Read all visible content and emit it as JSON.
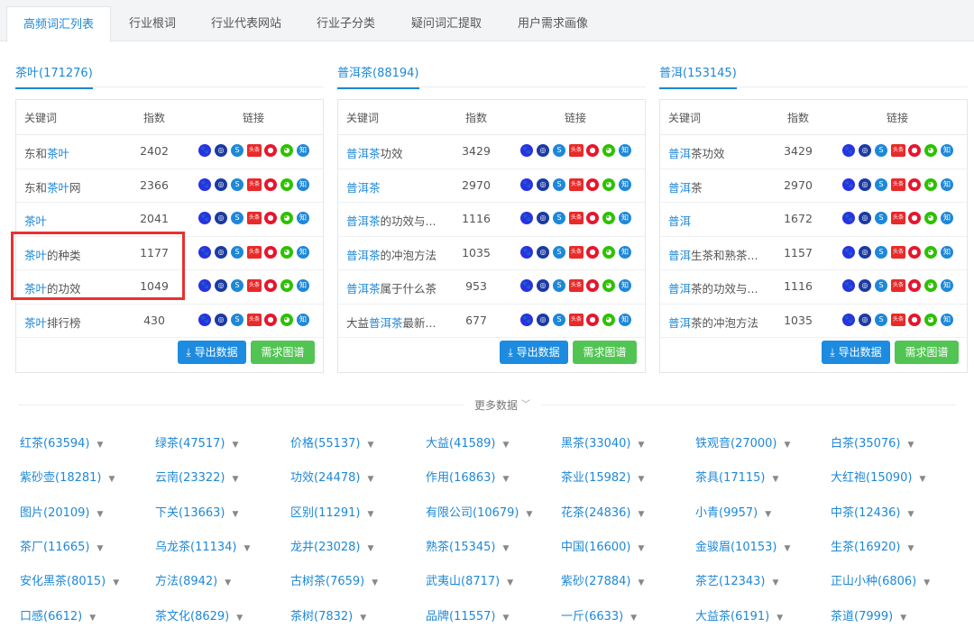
{
  "tabs": [
    "高频词汇列表",
    "行业根词",
    "行业代表网站",
    "行业子分类",
    "疑问词汇提取",
    "用户需求画像"
  ],
  "table_headers": {
    "keyword": "关键词",
    "index": "指数",
    "links": "链接"
  },
  "buttons": {
    "export": "导出数据",
    "map": "需求图谱"
  },
  "icon_labels": {
    "toutiao": "头条",
    "zhihu": "知"
  },
  "panels": [
    {
      "title": "茶叶(171276)",
      "rows": [
        {
          "pre": "东和",
          "hl": "茶叶",
          "post": "",
          "index": "2402"
        },
        {
          "pre": "东和",
          "hl": "茶叶",
          "post": "网",
          "index": "2366"
        },
        {
          "pre": "",
          "hl": "茶叶",
          "post": "",
          "index": "2041"
        },
        {
          "pre": "",
          "hl": "茶叶",
          "post": "的种类",
          "index": "1177"
        },
        {
          "pre": "",
          "hl": "茶叶",
          "post": "的功效",
          "index": "1049"
        },
        {
          "pre": "",
          "hl": "茶叶",
          "post": "排行榜",
          "index": "430"
        }
      ]
    },
    {
      "title": "普洱茶(88194)",
      "rows": [
        {
          "pre": "",
          "hl": "普洱茶",
          "post": "功效",
          "index": "3429"
        },
        {
          "pre": "",
          "hl": "普洱茶",
          "post": "",
          "index": "2970"
        },
        {
          "pre": "",
          "hl": "普洱茶",
          "post": "的功效与...",
          "index": "1116"
        },
        {
          "pre": "",
          "hl": "普洱茶",
          "post": "的冲泡方法",
          "index": "1035"
        },
        {
          "pre": "",
          "hl": "普洱茶",
          "post": "属于什么茶",
          "index": "953"
        },
        {
          "pre": "大益",
          "hl": "普洱茶",
          "post": "最新...",
          "index": "677"
        }
      ]
    },
    {
      "title": "普洱(153145)",
      "rows": [
        {
          "pre": "",
          "hl": "普洱",
          "post": "茶功效",
          "index": "3429"
        },
        {
          "pre": "",
          "hl": "普洱",
          "post": "茶",
          "index": "2970"
        },
        {
          "pre": "",
          "hl": "普洱",
          "post": "",
          "index": "1672"
        },
        {
          "pre": "",
          "hl": "普洱",
          "post": "生茶和熟茶...",
          "index": "1157"
        },
        {
          "pre": "",
          "hl": "普洱",
          "post": "茶的功效与...",
          "index": "1116"
        },
        {
          "pre": "",
          "hl": "普洱",
          "post": "茶的冲泡方法",
          "index": "1035"
        }
      ]
    }
  ],
  "more_data": "更多数据",
  "categories": [
    [
      "红茶(63594)",
      "绿茶(47517)",
      "价格(55137)",
      "大益(41589)",
      "黑茶(33040)",
      "铁观音(27000)",
      "白茶(35076)"
    ],
    [
      "紫砂壶(18281)",
      "云南(23322)",
      "功效(24478)",
      "作用(16863)",
      "茶业(15982)",
      "茶具(17115)",
      "大红袍(15090)"
    ],
    [
      "图片(20109)",
      "下关(13663)",
      "区别(11291)",
      "有限公司(10679)",
      "花茶(24836)",
      "小青(9957)",
      "中茶(12436)"
    ],
    [
      "茶厂(11665)",
      "乌龙茶(11134)",
      "龙井(23028)",
      "熟茶(15345)",
      "中国(16600)",
      "金骏眉(10153)",
      "生茶(16920)"
    ],
    [
      "安化黑茶(8015)",
      "方法(8942)",
      "古树茶(7659)",
      "武夷山(8717)",
      "紫砂(27884)",
      "茶艺(12343)",
      "正山小种(6806)"
    ],
    [
      "口感(6612)",
      "茶文化(8629)",
      "茶树(7832)",
      "品牌(11557)",
      "一斤(6633)",
      "大益茶(6191)",
      "茶道(7999)"
    ]
  ],
  "colors": {
    "accent": "#1e88d8",
    "baidu": "#2932e1",
    "so360": "#1b3aa3",
    "sogou": "#1e88d8",
    "toutiao": "#e82a2a",
    "weibo": "#e6162d",
    "wechat": "#2dc100",
    "zhihu": "#1e88d8",
    "highlight_box": "#e8312f"
  }
}
